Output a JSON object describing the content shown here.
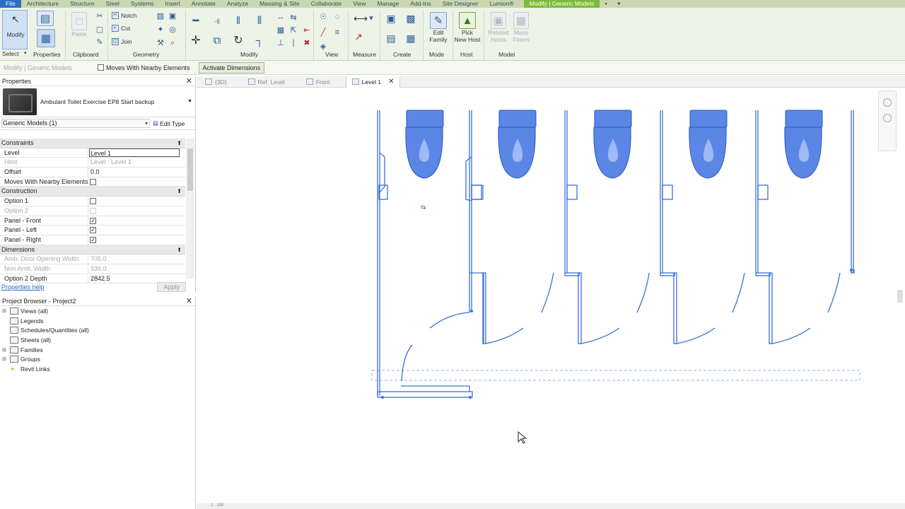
{
  "ribbon_tabs": [
    "File",
    "Architecture",
    "Structure",
    "Steel",
    "Systems",
    "Insert",
    "Annotate",
    "Analyze",
    "Massing & Site",
    "Collaborate",
    "View",
    "Manage",
    "Add-Ins",
    "Site Designer",
    "Lumion®",
    "Modify | Generic Models"
  ],
  "ribbon": {
    "modify": "Modify",
    "select": "Select",
    "properties": "Properties",
    "paste": "Paste",
    "clipboard": "Clipboard",
    "notch": "Notch",
    "cut": "Cut",
    "join": "Join",
    "geometry": "Geometry",
    "modify_panel": "Modify",
    "view_panel": "View",
    "measure_panel": "Measure",
    "create_panel": "Create",
    "edit_family_1": "Edit",
    "edit_family_2": "Family",
    "mode_panel": "Mode",
    "pick_new_host_1": "Pick",
    "pick_new_host_2": "New Host",
    "host_panel": "Host",
    "related_hosts_1": "Related",
    "related_hosts_2": "Hosts",
    "mass_floors_1": "Mass",
    "mass_floors_2": "Floors",
    "model_panel": "Model"
  },
  "options_bar": {
    "context": "Modify | Generic Models",
    "moves_with_nearby": "Moves With Nearby Elements",
    "activate_dimensions": "Activate Dimensions"
  },
  "properties": {
    "title": "Properties",
    "type_name": "Ambulant Toilet Exercise EP8 Start backup",
    "filter": "Generic Models (1)",
    "edit_type": "Edit Type",
    "groups": [
      {
        "name": "Constraints",
        "rows": [
          {
            "k": "Level",
            "v": "Level 1",
            "gray": false,
            "edit": true,
            "check": null
          },
          {
            "k": "Host",
            "v": "Level : Level 1",
            "gray": true,
            "edit": false,
            "check": null
          },
          {
            "k": "Offset",
            "v": "0.0",
            "gray": false,
            "edit": false,
            "check": null
          },
          {
            "k": "Moves With Nearby Elements",
            "v": "",
            "gray": false,
            "edit": false,
            "check": "off"
          }
        ]
      },
      {
        "name": "Construction",
        "rows": [
          {
            "k": "Option 1",
            "v": "",
            "gray": false,
            "edit": false,
            "check": "off"
          },
          {
            "k": "Option 2",
            "v": "",
            "gray": true,
            "edit": false,
            "check": "dim"
          },
          {
            "k": "Panel - Front",
            "v": "",
            "gray": false,
            "edit": false,
            "check": "on"
          },
          {
            "k": "Panel - Left",
            "v": "",
            "gray": false,
            "edit": false,
            "check": "on"
          },
          {
            "k": "Panel - Right",
            "v": "",
            "gray": false,
            "edit": false,
            "check": "on"
          }
        ]
      },
      {
        "name": "Dimensions",
        "rows": [
          {
            "k": "Amb. Door Opening Width",
            "v": "705.0",
            "gray": true,
            "edit": false,
            "check": null
          },
          {
            "k": "Non Amb. Width",
            "v": "936.0",
            "gray": true,
            "edit": false,
            "check": null
          },
          {
            "k": "Option 2 Depth",
            "v": "2842.5",
            "gray": false,
            "edit": false,
            "check": null
          }
        ]
      }
    ],
    "help": "Properties help",
    "apply": "Apply"
  },
  "browser": {
    "title": "Project Browser - Project2",
    "items": [
      {
        "label": "Views (all)",
        "exp": "+",
        "icon": "views"
      },
      {
        "label": "Legends",
        "exp": "",
        "icon": "legends"
      },
      {
        "label": "Schedules/Quantities (all)",
        "exp": "",
        "icon": "schedules"
      },
      {
        "label": "Sheets (all)",
        "exp": "",
        "icon": "sheets"
      },
      {
        "label": "Families",
        "exp": "+",
        "icon": "families"
      },
      {
        "label": "Groups",
        "exp": "+",
        "icon": "groups"
      },
      {
        "label": "Revit Links",
        "exp": "",
        "icon": "links"
      }
    ]
  },
  "view_tabs": [
    {
      "label": "{3D}",
      "active": false
    },
    {
      "label": "Ref. Level",
      "active": false
    },
    {
      "label": "Front",
      "active": false
    },
    {
      "label": "Level 1",
      "active": true
    }
  ],
  "status": "1 : 100"
}
